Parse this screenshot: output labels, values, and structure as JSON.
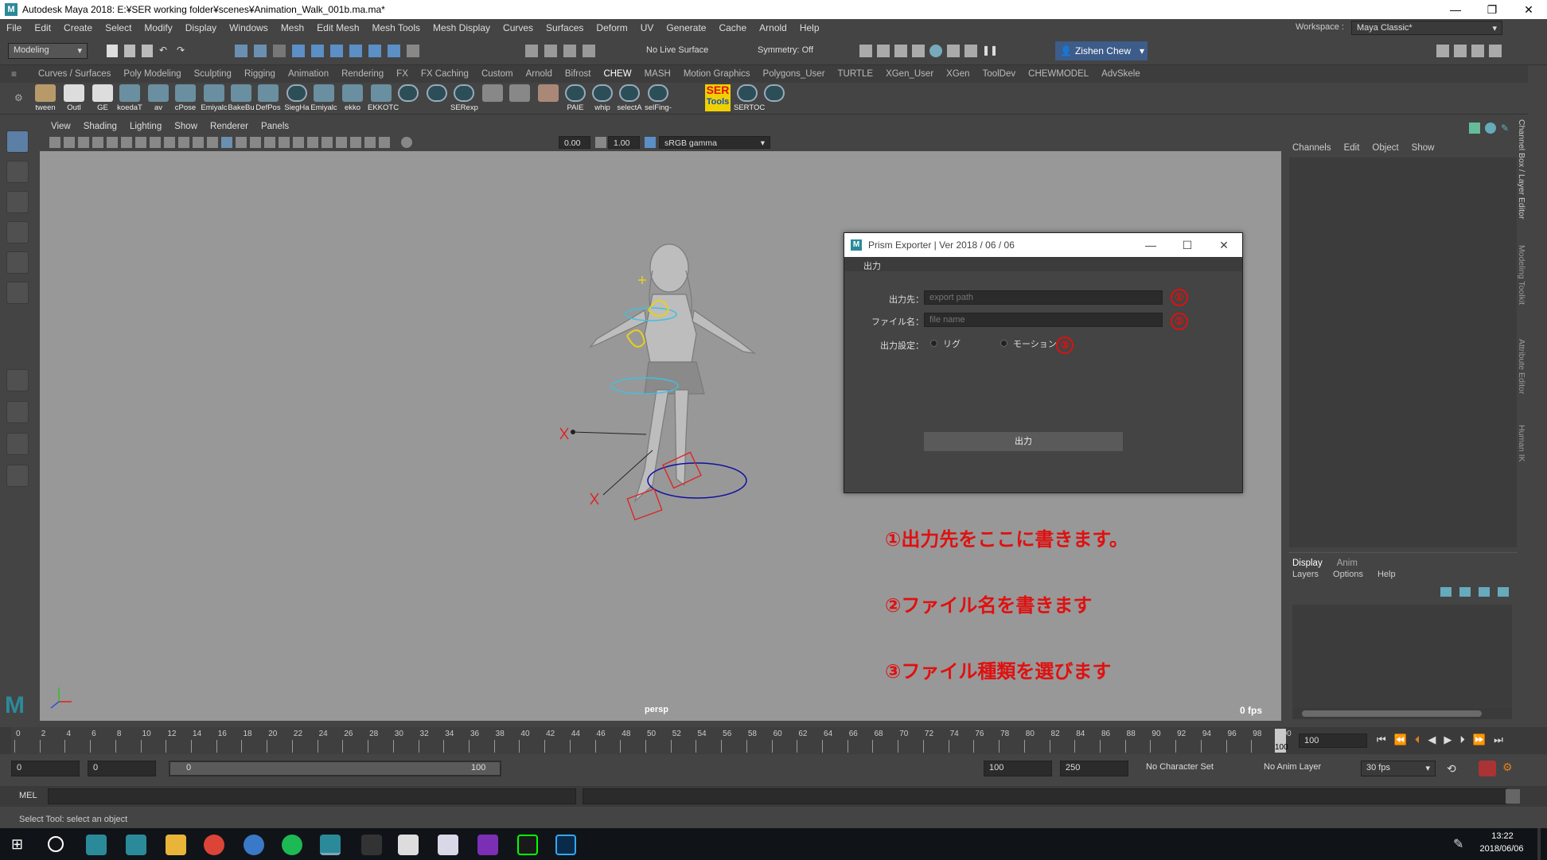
{
  "window": {
    "title": "Autodesk Maya 2018: E:¥SER working folder¥scenes¥Animation_Walk_001b.ma.ma*",
    "minimize": "—",
    "restore": "❐",
    "close": "✕"
  },
  "menu": [
    "File",
    "Edit",
    "Create",
    "Select",
    "Modify",
    "Display",
    "Windows",
    "Mesh",
    "Edit Mesh",
    "Mesh Tools",
    "Mesh Display",
    "Curves",
    "Surfaces",
    "Deform",
    "UV",
    "Generate",
    "Cache",
    "Arnold",
    "Help"
  ],
  "workspace": {
    "label": "Workspace :",
    "value": "Maya Classic*"
  },
  "statusline": {
    "mode": "Modeling",
    "live_surface": "No Live Surface",
    "symmetry": "Symmetry: Off",
    "user": "Zishen Chew"
  },
  "shelf_tabs": [
    "Curves / Surfaces",
    "Poly Modeling",
    "Sculpting",
    "Rigging",
    "Animation",
    "Rendering",
    "FX",
    "FX Caching",
    "Custom",
    "Arnold",
    "Bifrost",
    "CHEW",
    "MASH",
    "Motion Graphics",
    "Polygons_User",
    "TURTLE",
    "XGen_User",
    "XGen",
    "ToolDev",
    "CHEWMODEL",
    "AdvSkele"
  ],
  "shelf_active": "CHEW",
  "shelf_buttons": [
    "tween",
    "Outl",
    "GE",
    "koedaT",
    "av",
    "cPose",
    "Emiyalc",
    "BakeBu",
    "DefPos",
    "SiegHa",
    "Emiyalc",
    "ekko",
    "EKKOTC",
    "",
    "",
    "SERexp",
    "",
    "",
    "",
    "PAIE",
    "whip",
    "selectA",
    "selFing-",
    "",
    "SERTOC",
    ""
  ],
  "ser_tools": {
    "top": "SER",
    "bottom": "Tools"
  },
  "panel_menu": [
    "View",
    "Shading",
    "Lighting",
    "Show",
    "Renderer",
    "Panels"
  ],
  "panel_fields": {
    "exposure": "0.00",
    "gamma": "1.00",
    "colorspace": "sRGB gamma"
  },
  "viewport": {
    "camera": "persp",
    "fps": "0 fps"
  },
  "channel_box": {
    "menu": [
      "Channels",
      "Edit",
      "Object",
      "Show"
    ]
  },
  "side_tabs": [
    "Channel Box / Layer Editor",
    "Modeling Toolkit",
    "Attribute Editor",
    "Human IK"
  ],
  "layer_editor": {
    "tabs": [
      "Display",
      "Anim"
    ],
    "menu": [
      "Layers",
      "Options",
      "Help"
    ]
  },
  "dialog": {
    "title": "Prism Exporter | Ver 2018 / 06 / 06",
    "menu": "出力",
    "fields": [
      {
        "label": "出力先：",
        "placeholder": "export path",
        "marker": "①"
      },
      {
        "label": "ファイル名：",
        "placeholder": "file name",
        "marker": "②"
      }
    ],
    "setting_label": "出力設定：",
    "radio_options": [
      "リグ",
      "モーション"
    ],
    "radio_marker": "③",
    "button": "出力"
  },
  "annotations": [
    "①出力先をここに書きます。",
    "②ファイル名を書きます",
    "③ファイル種類を選びます"
  ],
  "timeline": {
    "ticks": [
      "0",
      "2",
      "4",
      "6",
      "8",
      "10",
      "12",
      "14",
      "16",
      "18",
      "20",
      "22",
      "24",
      "26",
      "28",
      "30",
      "32",
      "34",
      "36",
      "38",
      "40",
      "42",
      "44",
      "46",
      "48",
      "50",
      "52",
      "54",
      "56",
      "58",
      "60",
      "62",
      "64",
      "66",
      "68",
      "70",
      "72",
      "74",
      "76",
      "78",
      "80",
      "82",
      "84",
      "86",
      "88",
      "90",
      "92",
      "94",
      "96",
      "98",
      "100"
    ],
    "current_frame": "100",
    "end_marker": "100"
  },
  "range": {
    "start": "0",
    "start2": "0",
    "slider_start": "0",
    "slider_end": "100",
    "end": "100",
    "end2": "250",
    "character_set": "No Character Set",
    "anim_layer": "No Anim Layer",
    "fps": "30 fps"
  },
  "mel": {
    "label": "MEL"
  },
  "help_line": "Select Tool: select an object",
  "taskbar": {
    "time": "13:22",
    "date": "2018/06/06"
  },
  "colors": {
    "accent": "#5b7fa5",
    "annotation": "#e01010",
    "viewport_bg": "#989898"
  }
}
